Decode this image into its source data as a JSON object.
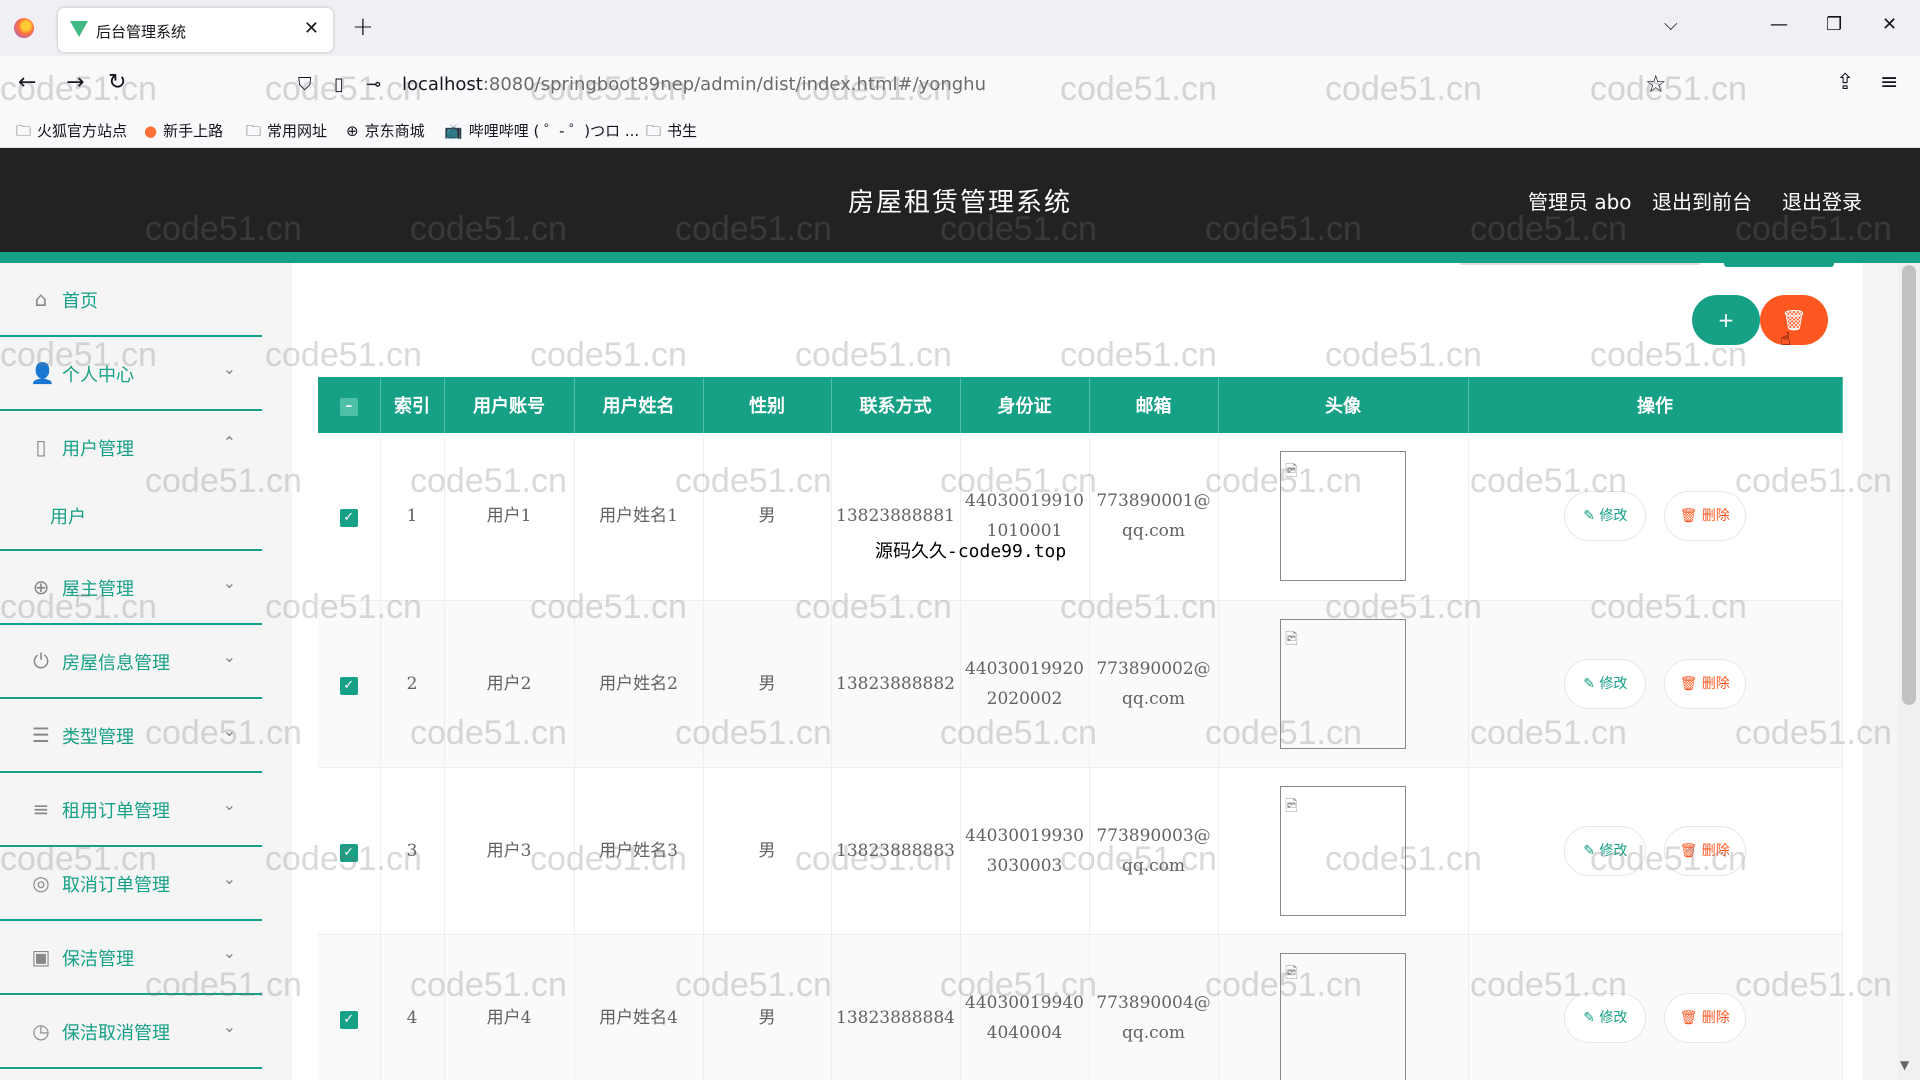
{
  "browser": {
    "tab_title": "后台管理系统",
    "url_host": "localhost",
    "url_rest": ":8080/springboot89nep/admin/dist/index.html#/yonghu",
    "bookmarks": [
      "火狐官方站点",
      "新手上路",
      "常用网址",
      "京东商城",
      "哔哩哔哩 ( ゜- ゜)つロ ...",
      "书生"
    ]
  },
  "header": {
    "title": "房屋租赁管理系统",
    "admin_label": "管理员 abo",
    "exit_front": "退出到前台",
    "logout": "退出登录"
  },
  "sidebar": {
    "items": [
      {
        "label": "首页",
        "icon": "home-icon"
      },
      {
        "label": "个人中心",
        "icon": "person-icon"
      },
      {
        "label": "用户管理",
        "icon": "phone-icon"
      },
      {
        "label": "屋主管理",
        "icon": "globe-icon"
      },
      {
        "label": "房屋信息管理",
        "icon": "power-icon"
      },
      {
        "label": "类型管理",
        "icon": "sliders-icon"
      },
      {
        "label": "租用订单管理",
        "icon": "list-icon"
      },
      {
        "label": "取消订单管理",
        "icon": "target-icon"
      },
      {
        "label": "保洁管理",
        "icon": "clipboard-icon"
      },
      {
        "label": "保洁取消管理",
        "icon": "compass-icon"
      }
    ],
    "sub_user": "用户"
  },
  "actions": {
    "add": "+",
    "delete": "🗑"
  },
  "table": {
    "headers": [
      "",
      "索引",
      "用户账号",
      "用户姓名",
      "性别",
      "联系方式",
      "身份证",
      "邮箱",
      "头像",
      "操作"
    ],
    "edit_label": "✎ 修改",
    "delete_label": "🗑 删除",
    "rows": [
      {
        "index": "1",
        "account": "用户1",
        "name": "用户姓名1",
        "gender": "男",
        "phone": "13823888881",
        "id_a": "44030019910",
        "id_b": "1010001",
        "email_a": "773890001@",
        "email_b": "qq.com"
      },
      {
        "index": "2",
        "account": "用户2",
        "name": "用户姓名2",
        "gender": "男",
        "phone": "13823888882",
        "id_a": "44030019920",
        "id_b": "2020002",
        "email_a": "773890002@",
        "email_b": "qq.com"
      },
      {
        "index": "3",
        "account": "用户3",
        "name": "用户姓名3",
        "gender": "男",
        "phone": "13823888883",
        "id_a": "44030019930",
        "id_b": "3030003",
        "email_a": "773890003@",
        "email_b": "qq.com"
      },
      {
        "index": "4",
        "account": "用户4",
        "name": "用户姓名4",
        "gender": "男",
        "phone": "13823888884",
        "id_a": "44030019940",
        "id_b": "4040004",
        "email_a": "773890004@",
        "email_b": "qq.com"
      }
    ]
  },
  "overlay": "源码久久-code99.top",
  "watermark": "code51.cn"
}
